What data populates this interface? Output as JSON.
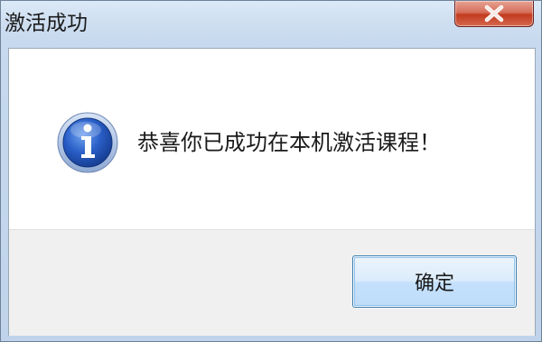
{
  "window": {
    "title": "激活成功"
  },
  "dialog": {
    "icon": "info-icon",
    "message": "恭喜你已成功在本机激活课程！"
  },
  "buttons": {
    "ok_label": "确定",
    "close_icon": "close-icon"
  },
  "colors": {
    "titlebar": "#c6d9ee",
    "close_button": "#c23b1f",
    "info_icon": "#1d4fb3",
    "footer": "#f0f0f0",
    "ok_button_border": "#3c7fb1"
  }
}
